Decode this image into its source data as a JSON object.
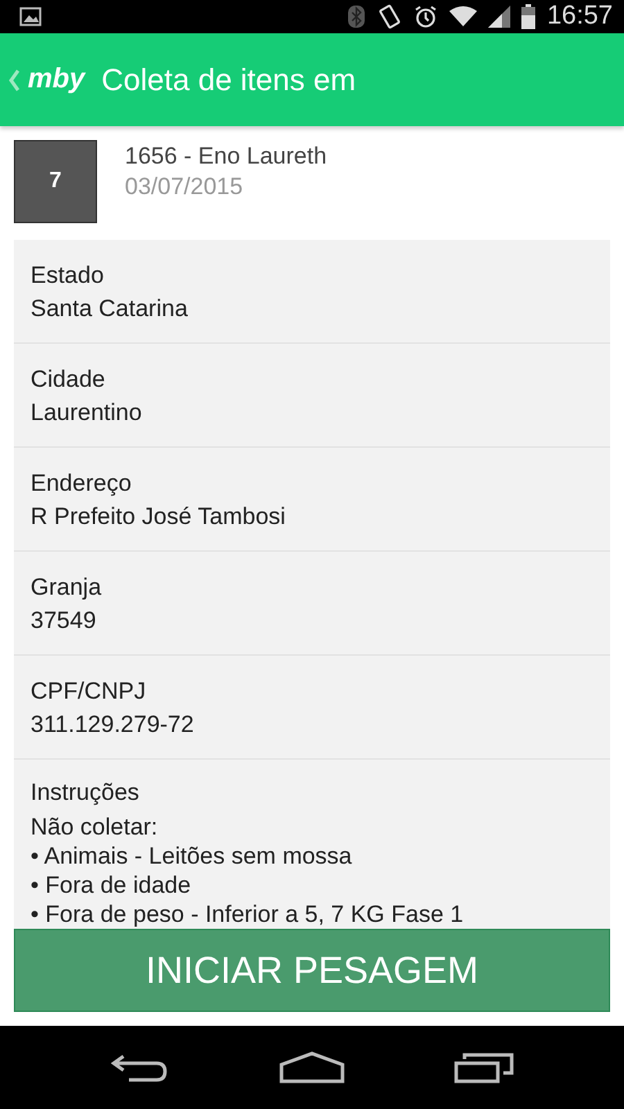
{
  "status_bar": {
    "time": "16:57"
  },
  "app_bar": {
    "logo": "mby",
    "title": "Coleta de itens em"
  },
  "header": {
    "badge": "7",
    "title": "1656 - Eno Laureth",
    "date": "03/07/2015"
  },
  "fields": [
    {
      "label": "Estado",
      "value": "Santa Catarina"
    },
    {
      "label": "Cidade",
      "value": "Laurentino"
    },
    {
      "label": "Endereço",
      "value": "R Prefeito José Tambosi"
    },
    {
      "label": "Granja",
      "value": "37549"
    },
    {
      "label": "CPF/CNPJ",
      "value": "311.129.279-72"
    }
  ],
  "instructions": {
    "label": "Instruções",
    "lines": [
      "Não coletar:",
      "• Animais - Leitões sem mossa",
      "• Fora de idade",
      "• Fora de peso - Inferior a 5, 7 KG Fase 1"
    ]
  },
  "action_button": "INICIAR PESAGEM"
}
